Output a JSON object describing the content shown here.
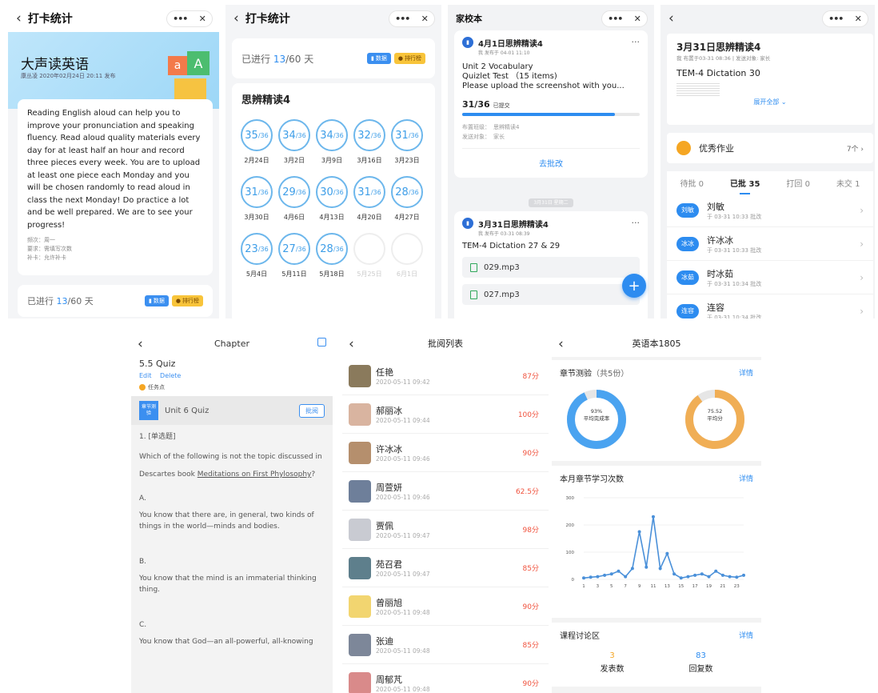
{
  "capsule": {
    "more": "•••",
    "close": "✕"
  },
  "p1": {
    "title": "打卡统计",
    "banner_title": "大声读英语",
    "banner_meta": "康丛凌 2020年02月24日 20:11 发布",
    "block_letters": [
      "a",
      "A"
    ],
    "description": "Reading English aloud can help you to improve your pronunciation and speaking fluency. Read aloud quality materials every day for at least half an hour and record three pieces every week. You are to upload at least one piece each Monday and you will be chosen randomly to read aloud in class the next Monday! Do practice a lot and be well prepared. We are to see your progress!",
    "info": [
      "频次：周一",
      "要求：需填写次数",
      "补卡：允许补卡"
    ],
    "progress_prefix": "已进行 ",
    "progress_value": "13",
    "progress_suffix": "/60 天",
    "badge_data": "数据",
    "badge_rank": "排行榜"
  },
  "p2": {
    "title": "打卡统计",
    "progress_prefix": "已进行 ",
    "progress_value": "13",
    "progress_suffix": "/60 天",
    "badge_data": "数据",
    "badge_rank": "排行榜",
    "section_title": "思辨精读4",
    "days": [
      {
        "num": "35",
        "total": "/36",
        "date": "2月24日"
      },
      {
        "num": "34",
        "total": "/36",
        "date": "3月2日"
      },
      {
        "num": "34",
        "total": "/36",
        "date": "3月9日"
      },
      {
        "num": "32",
        "total": "/36",
        "date": "3月16日"
      },
      {
        "num": "31",
        "total": "/36",
        "date": "3月23日"
      },
      {
        "num": "31",
        "total": "/36",
        "date": "3月30日"
      },
      {
        "num": "29",
        "total": "/36",
        "date": "4月6日"
      },
      {
        "num": "30",
        "total": "/36",
        "date": "4月13日"
      },
      {
        "num": "31",
        "total": "/36",
        "date": "4月20日"
      },
      {
        "num": "28",
        "total": "/36",
        "date": "4月27日"
      },
      {
        "num": "23",
        "total": "/36",
        "date": "5月4日"
      },
      {
        "num": "27",
        "total": "/36",
        "date": "5月11日"
      },
      {
        "num": "28",
        "total": "/36",
        "date": "5月18日"
      },
      {
        "num": "",
        "total": "",
        "date": "5月25日"
      },
      {
        "num": "",
        "total": "",
        "date": "6月1日"
      }
    ]
  },
  "p3": {
    "title": "家校本",
    "card1": {
      "title": "4月1日思辨精读4",
      "meta": "我 发布于 04-01 11:10",
      "lines": [
        "Unit 2 Vocabulary",
        "Quizlet Test （15 items)",
        "Please upload the screenshot with you..."
      ],
      "count": "31/36",
      "count_suffix": "已提交",
      "progress": 0.86,
      "class_label": "布置班级：",
      "class_value": "思辨精读4",
      "target_label": "发送对象：",
      "target_value": "家长",
      "action": "去批改",
      "more": "···"
    },
    "divider": "3月31日 星期二",
    "card2": {
      "title": "3月31日思辨精读4",
      "meta": "我 发布于 03-31 08:39",
      "line": "TEM-4 Dictation 27 & 29",
      "files": [
        "029.mp3",
        "027.mp3"
      ],
      "more": "···"
    },
    "fab": "+"
  },
  "p4": {
    "title": "3月31日思辨精读4",
    "meta": "我 布置于03-31 08:36 | 发送对象: 家长",
    "body": "TEM-4 Dictation 30",
    "expand": "展开全部 ⌄",
    "excellent_label": "优秀作业",
    "excellent_count": "7个 ›",
    "tabs": [
      "待批 0",
      "已批 35",
      "打回 0",
      "未交 1"
    ],
    "rows": [
      {
        "avatar": "刘敏",
        "name": "刘敏",
        "time": "于 03-31 10:33 批改"
      },
      {
        "avatar": "冰冰",
        "name": "许冰冰",
        "time": "于 03-31 10:33 批改"
      },
      {
        "avatar": "冰茹",
        "name": "时冰茹",
        "time": "于 03-31 10:34 批改"
      },
      {
        "avatar": "连容",
        "name": "连容",
        "time": "于 03-31 10:34 批改"
      }
    ]
  },
  "p5": {
    "title": "Chapter",
    "quiz_name": "5.5 Quiz",
    "edit": "Edit",
    "delete": "Delete",
    "task_point": "任务点",
    "tag": "章节测验",
    "unit": "Unit 6 Quiz",
    "review_btn": "批阅",
    "question_type": "1. [单选题]",
    "question_pre": "Which of the following is not the topic discussed in Descartes book ",
    "question_link": "Meditations on First Phylosophy",
    "question_post": "?",
    "options": [
      {
        "label": "A.",
        "text": "You know that there are, in general, two kinds of things in the world—minds and bodies."
      },
      {
        "label": "B.",
        "text": "You know that the mind is an immaterial thinking thing."
      },
      {
        "label": "C.",
        "text": "You know that God—an all-powerful, all-knowing"
      }
    ]
  },
  "p6": {
    "title": "批阅列表",
    "rows": [
      {
        "name": "任艳",
        "time": "2020-05-11 09:42",
        "score": "87分",
        "color": "#8a7a5c"
      },
      {
        "name": "郝丽冰",
        "time": "2020-05-11 09:44",
        "score": "100分",
        "color": "#d9b4a0"
      },
      {
        "name": "许冰冰",
        "time": "2020-05-11 09:46",
        "score": "90分",
        "color": "#b58f6d"
      },
      {
        "name": "周萱妍",
        "time": "2020-05-11 09:46",
        "score": "62.5分",
        "color": "#6e7f9a"
      },
      {
        "name": "贾佩",
        "time": "2020-05-11 09:47",
        "score": "98分",
        "color": "#c9cbd2"
      },
      {
        "name": "苑召君",
        "time": "2020-05-11 09:47",
        "score": "85分",
        "color": "#5e7f8c"
      },
      {
        "name": "曾丽旭",
        "time": "2020-05-11 09:48",
        "score": "90分",
        "color": "#f2d570"
      },
      {
        "name": "张迪",
        "time": "2020-05-11 09:48",
        "score": "85分",
        "color": "#7d8799"
      },
      {
        "name": "周郁芃",
        "time": "2020-05-11 09:48",
        "score": "90分",
        "color": "#d98a8a"
      }
    ]
  },
  "p7": {
    "title": "英语本1805",
    "sec1_title": "章节测验",
    "sec1_count": "（共5份）",
    "detail": "详情",
    "donut1": {
      "value": "93%",
      "label": "平均完成率",
      "fraction": 0.93,
      "color": "#4aa3f0"
    },
    "donut2": {
      "value": "75.52",
      "label": "平均分",
      "fraction": 0.9,
      "color": "#f0ae55"
    },
    "sec2_title": "本月章节学习次数",
    "sec3_title": "课程讨论区",
    "posts_value": "3",
    "posts_label": "发表数",
    "replies_value": "83",
    "replies_label": "回复数"
  },
  "chart_data": {
    "type": "line",
    "title": "本月章节学习次数",
    "x": [
      1,
      2,
      3,
      4,
      5,
      6,
      7,
      8,
      9,
      10,
      11,
      12,
      13,
      14,
      15,
      16,
      17,
      18,
      19,
      20,
      21,
      22,
      23,
      24
    ],
    "values": [
      5,
      8,
      10,
      15,
      20,
      30,
      10,
      40,
      175,
      45,
      230,
      40,
      95,
      20,
      5,
      10,
      15,
      20,
      10,
      30,
      15,
      10,
      8,
      15
    ],
    "xticks": [
      "1",
      "3",
      "5",
      "7",
      "9",
      "11",
      "13",
      "15",
      "17",
      "19",
      "21",
      "23"
    ],
    "yticks": [
      "0",
      "100",
      "200",
      "300"
    ],
    "ylim": [
      0,
      300
    ],
    "color": "#4a90d9"
  }
}
